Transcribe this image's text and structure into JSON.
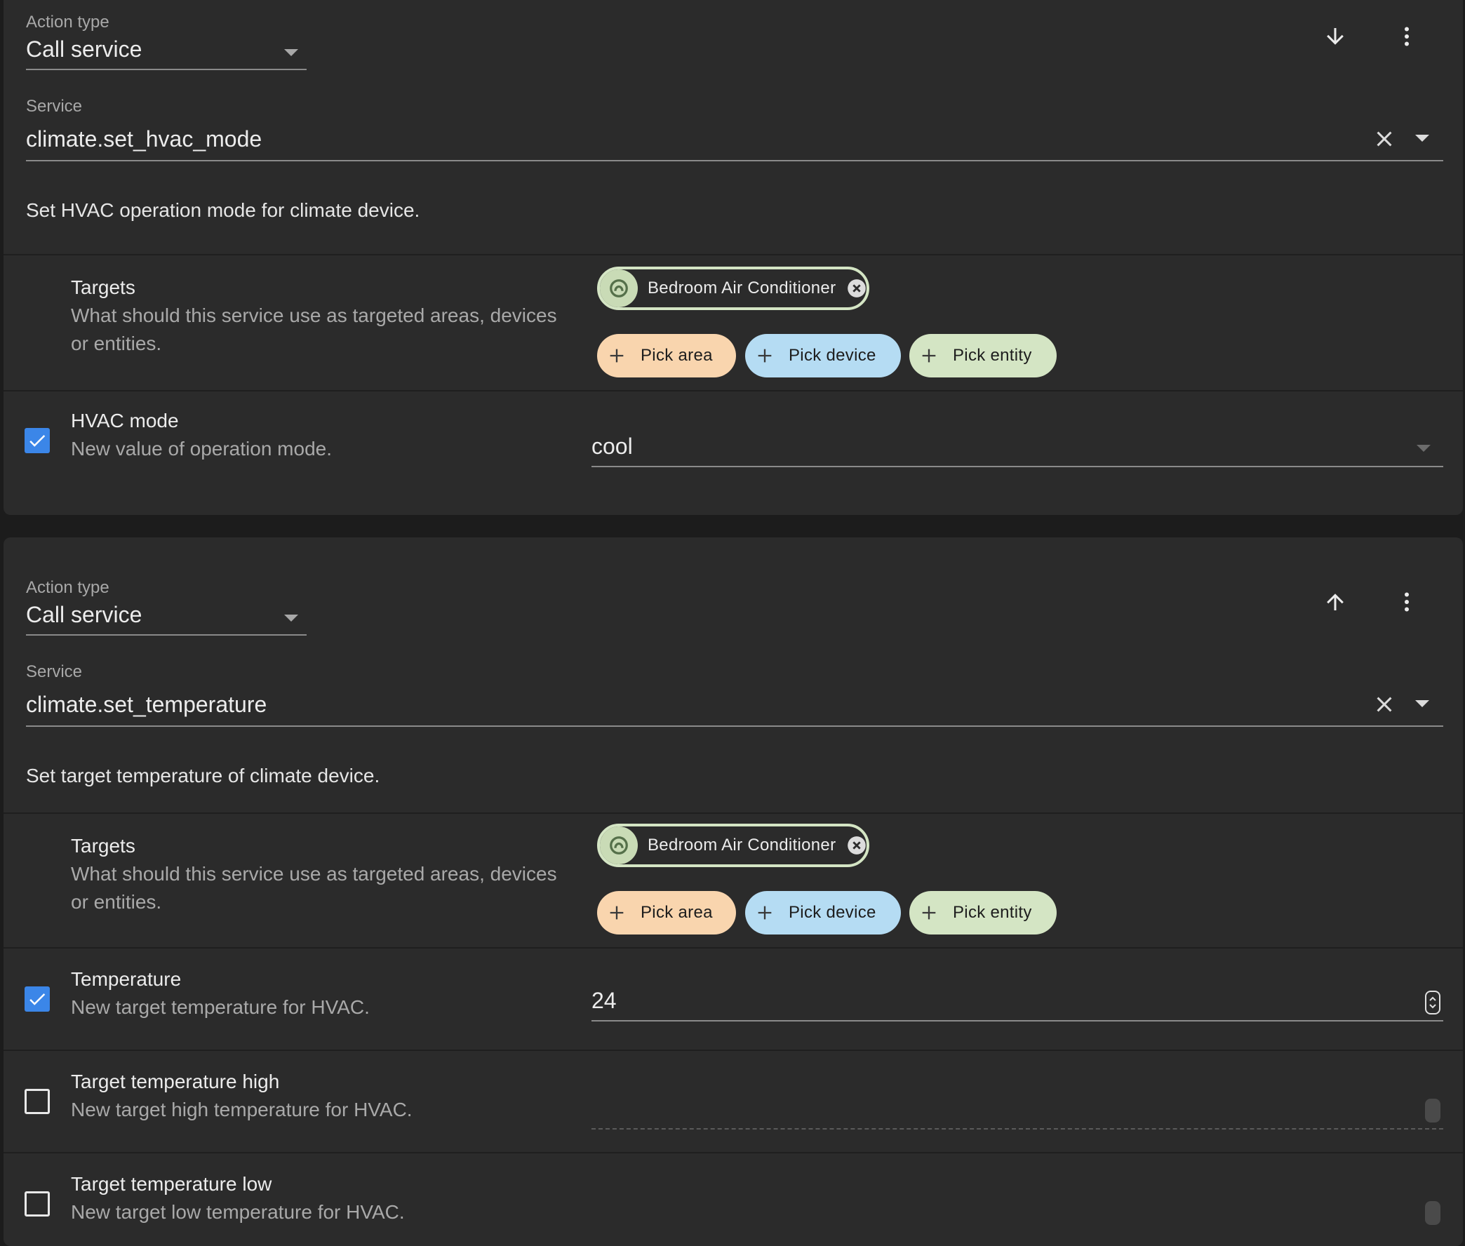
{
  "actions": [
    {
      "action_type_label": "Action type",
      "action_type_value": "Call service",
      "move_icon": "arrow-down-icon",
      "menu_icon": "more-vertical-icon",
      "service_label": "Service",
      "service_value": "climate.set_hvac_mode",
      "service_description": "Set HVAC operation mode for climate device.",
      "targets": {
        "title": "Targets",
        "description": "What should this service use as targeted areas, devices or entities.",
        "selected_entity": "Bedroom Air Conditioner",
        "pick_area": "Pick area",
        "pick_device": "Pick device",
        "pick_entity": "Pick entity"
      },
      "fields": [
        {
          "title": "HVAC mode",
          "description": "New value of operation mode.",
          "checked": true,
          "value": "cool",
          "input_kind": "select"
        }
      ]
    },
    {
      "action_type_label": "Action type",
      "action_type_value": "Call service",
      "move_icon": "arrow-up-icon",
      "menu_icon": "more-vertical-icon",
      "service_label": "Service",
      "service_value": "climate.set_temperature",
      "service_description": "Set target temperature of climate device.",
      "targets": {
        "title": "Targets",
        "description": "What should this service use as targeted areas, devices or entities.",
        "selected_entity": "Bedroom Air Conditioner",
        "pick_area": "Pick area",
        "pick_device": "Pick device",
        "pick_entity": "Pick entity"
      },
      "fields": [
        {
          "title": "Temperature",
          "description": "New target temperature for HVAC.",
          "checked": true,
          "value": "24",
          "input_kind": "number"
        },
        {
          "title": "Target temperature high",
          "description": "New target high temperature for HVAC.",
          "checked": false,
          "value": "",
          "input_kind": "number-disabled"
        },
        {
          "title": "Target temperature low",
          "description": "New target low temperature for HVAC.",
          "checked": false,
          "value": "",
          "input_kind": "number-disabled"
        }
      ]
    }
  ],
  "colors": {
    "background": "#1c1c1c",
    "card": "#2b2b2b",
    "checkbox_accent": "#3b86e8",
    "chip_area": "#f9d5ae",
    "chip_device": "#b5dcf3",
    "chip_entity": "#d4e5c4"
  }
}
